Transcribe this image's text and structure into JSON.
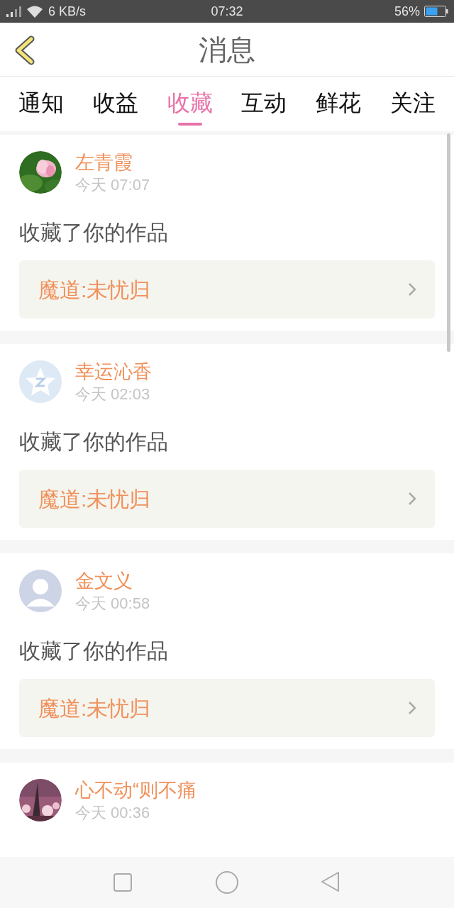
{
  "status_bar": {
    "speed": "6 KB/s",
    "time": "07:32",
    "battery": "56%"
  },
  "header": {
    "title": "消息"
  },
  "tabs": [
    {
      "label": "通知",
      "selected": false
    },
    {
      "label": "收益",
      "selected": false
    },
    {
      "label": "收藏",
      "selected": true
    },
    {
      "label": "互动",
      "selected": false
    },
    {
      "label": "鲜花",
      "selected": false
    },
    {
      "label": "关注",
      "selected": false
    }
  ],
  "messages": [
    {
      "name": "左青霞",
      "time": "今天 07:07",
      "action": "收藏了你的作品",
      "work": "魔道:未忧归"
    },
    {
      "avatar": {
        "kind": "star"
      },
      "name": "幸运沁香",
      "time": "今天 02:03",
      "action": "收藏了你的作品",
      "work": "魔道:未忧归"
    },
    {
      "avatar": {
        "kind": "person"
      },
      "name": "金文义",
      "time": "今天 00:58",
      "action": "收藏了你的作品",
      "work": "魔道:未忧归"
    },
    {
      "name": "心不动“则不痛",
      "time": "今天 00:36"
    }
  ]
}
